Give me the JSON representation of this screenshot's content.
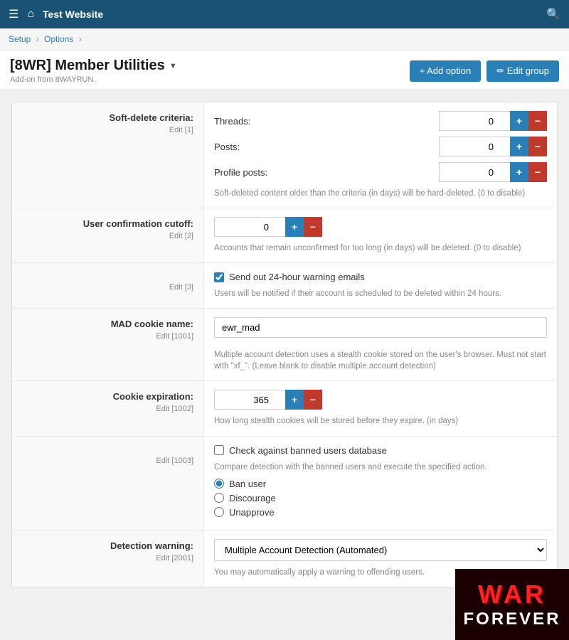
{
  "topbar": {
    "title": "Test Website",
    "menu_icon": "☰",
    "home_icon": "⌂",
    "search_icon": "🔍"
  },
  "breadcrumb": {
    "setup": "Setup",
    "options": "Options",
    "separator": "›"
  },
  "page": {
    "title": "[8WR] Member Utilities",
    "dropdown_icon": "▼",
    "subtitle": "Add-on from 8WAYRUN.",
    "add_option_label": "+ Add option",
    "edit_group_label": "✏ Edit group"
  },
  "options": {
    "soft_delete": {
      "label": "Soft-delete criteria:",
      "edit_link": "Edit [1]",
      "threads_label": "Threads:",
      "threads_value": "0",
      "posts_label": "Posts:",
      "posts_value": "0",
      "profile_posts_label": "Profile posts:",
      "profile_posts_value": "0",
      "hint": "Soft-deleted content older than the criteria (in days) will be hard-deleted. (0 to disable)"
    },
    "user_confirmation": {
      "label": "User confirmation cutoff:",
      "edit_link": "Edit [2]",
      "value": "0",
      "hint": "Accounts that remain unconfirmed for too long (in days) will be deleted. (0 to disable)"
    },
    "send_warning": {
      "edit_link": "Edit [3]",
      "checkbox_label": "Send out 24-hour warning emails",
      "hint": "Users will be notified if their account is scheduled to be deleted within 24 hours."
    },
    "mad_cookie": {
      "label": "MAD cookie name:",
      "edit_link": "Edit [1001]",
      "value": "ewr_mad",
      "hint": "Multiple account detection uses a stealth cookie stored on the user's browser. Must not start with \"xf_\". (Leave blank to disable multiple account detection)"
    },
    "cookie_expiration": {
      "label": "Cookie expiration:",
      "edit_link": "Edit [1002]",
      "value": "365",
      "hint": "How long stealth cookies will be stored before they expire. (in days)"
    },
    "banned_users": {
      "edit_link": "Edit [1003]",
      "checkbox_label": "Check against banned users database",
      "hint": "Compare detection with the banned users and execute the specified action.",
      "radio_ban": "Ban user",
      "radio_discourage": "Discourage",
      "radio_unapprove": "Unapprove"
    },
    "detection_warning": {
      "label": "Detection warning:",
      "edit_link": "Edit [2001]",
      "value": "Multiple Account Detection (Automated)",
      "hint": "You may automatically apply a warning to offending users."
    }
  },
  "watermark": {
    "line1": "WAR",
    "line2": "FOREVER"
  }
}
